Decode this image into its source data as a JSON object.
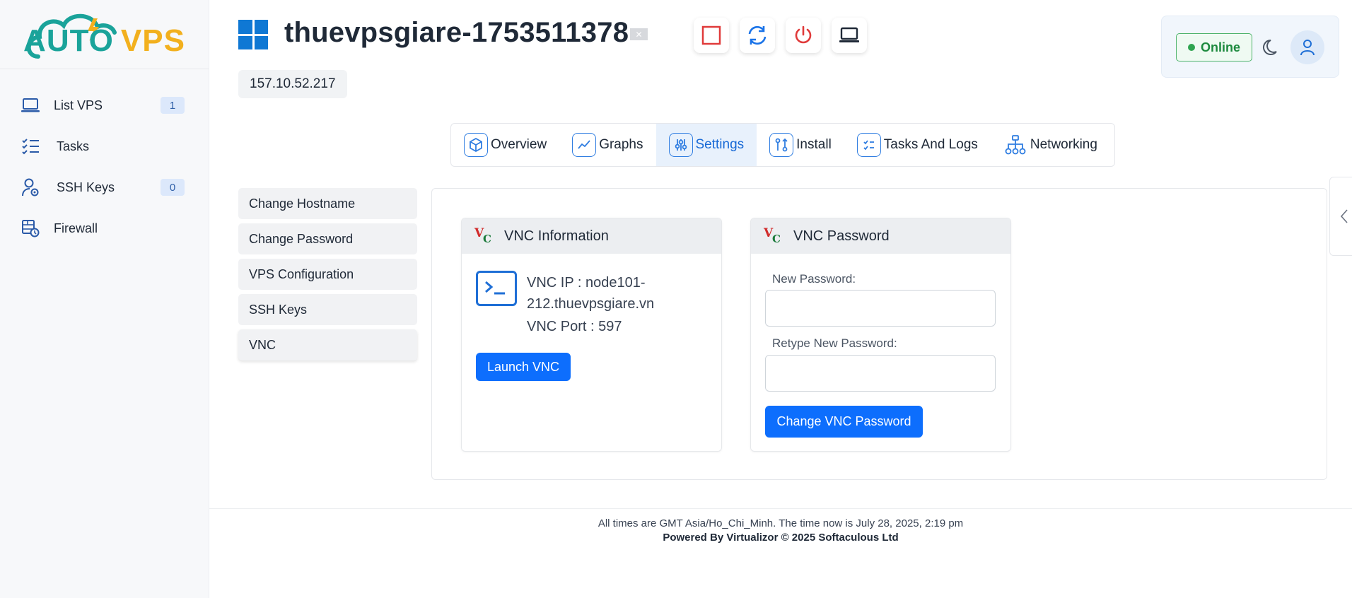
{
  "logo": {
    "part1": "AUTO",
    "part2": "VPS"
  },
  "sidebar": {
    "items": [
      {
        "label": "List VPS",
        "badge": "1",
        "icon": "laptop-icon"
      },
      {
        "label": "Tasks",
        "icon": "checklist-icon"
      },
      {
        "label": "SSH Keys",
        "badge": "0",
        "icon": "user-key-icon"
      },
      {
        "label": "Firewall",
        "icon": "firewall-icon"
      }
    ]
  },
  "header": {
    "title": "thuevpsgiare-1753511378",
    "ip": "157.10.52.217",
    "status": "Online",
    "actions": [
      "stop",
      "restart",
      "power-off",
      "console"
    ]
  },
  "tabs": [
    {
      "label": "Overview"
    },
    {
      "label": "Graphs"
    },
    {
      "label": "Settings",
      "active": true
    },
    {
      "label": "Install"
    },
    {
      "label": "Tasks And Logs"
    },
    {
      "label": "Networking"
    }
  ],
  "submenu": [
    {
      "label": "Change Hostname"
    },
    {
      "label": "Change Password"
    },
    {
      "label": "VPS Configuration"
    },
    {
      "label": "SSH Keys"
    },
    {
      "label": "VNC",
      "active": true
    }
  ],
  "vnc_info": {
    "title": "VNC Information",
    "ip_line1": "VNC IP : node101-",
    "ip_line2": "212.thuevpsgiare.vn",
    "port": "VNC Port : 597",
    "launch_label": "Launch VNC"
  },
  "vnc_password": {
    "title": "VNC Password",
    "new_label": "New Password:",
    "new_value": "",
    "retype_label": "Retype New Password:",
    "retype_value": "",
    "submit_label": "Change VNC Password"
  },
  "footer": {
    "time_note": "All times are GMT Asia/Ho_Chi_Minh. The time now is July 28, 2025, 2:19 pm",
    "powered": "Powered By Virtualizor © 2025 Softaculous Ltd"
  },
  "colors": {
    "primary": "#0d6efd",
    "accent_blue": "#2f7de1",
    "online_green": "#1d8a3e",
    "stop_red": "#e03a3a",
    "logo_teal": "#1aa39a",
    "logo_yellow": "#f2b01e"
  }
}
